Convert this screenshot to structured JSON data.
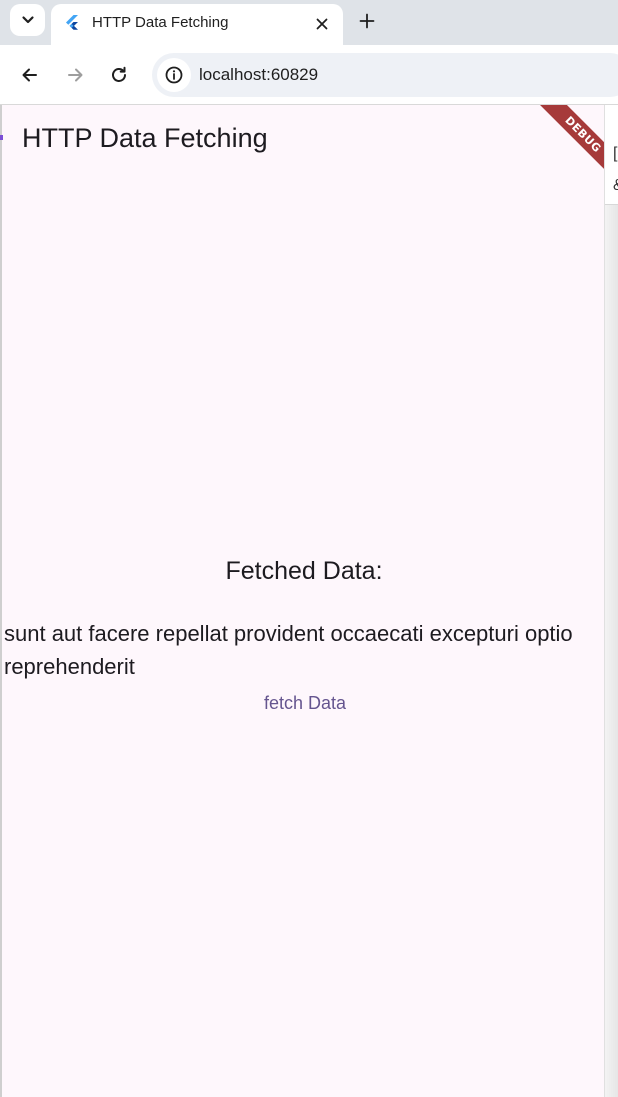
{
  "browser": {
    "tab": {
      "title": "HTTP Data Fetching",
      "favicon": "flutter-icon"
    },
    "address_bar": {
      "url": "localhost:60829"
    },
    "icons": {
      "tab_search": "chevron-down-icon",
      "close_tab": "close-icon",
      "new_tab": "plus-icon",
      "back": "arrow-left-icon",
      "forward": "arrow-right-icon",
      "reload": "reload-icon",
      "site_info": "info-icon"
    }
  },
  "app": {
    "title": "HTTP Data Fetching",
    "debug_banner": "DEBUG",
    "fetched_heading": "Fetched Data:",
    "fetched_text": "sunt aut facere repellat provident occaecati excepturi optio reprehenderit",
    "fetch_button_label": "fetch Data"
  },
  "colors": {
    "page_background": "#fef7fc",
    "button_text": "#65558f",
    "debug_banner": "#a63a3a",
    "tabstrip": "#dfe3e8"
  }
}
